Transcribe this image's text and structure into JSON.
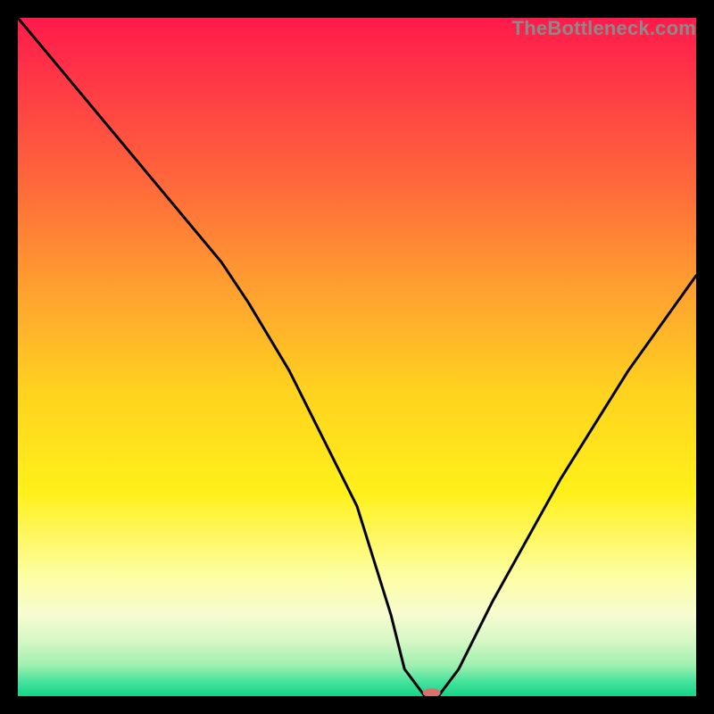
{
  "watermark": "TheBottleneck.com",
  "chart_data": {
    "type": "line",
    "title": "",
    "xlabel": "",
    "ylabel": "",
    "xlim": [
      0,
      100
    ],
    "ylim": [
      0,
      100
    ],
    "grid": false,
    "legend": false,
    "series": [
      {
        "name": "bottleneck-curve",
        "x": [
          0,
          10,
          20,
          30,
          34,
          40,
          50,
          55,
          57,
          60,
          62,
          65,
          70,
          80,
          90,
          100
        ],
        "y": [
          100,
          88,
          76,
          64,
          58,
          48,
          28,
          12,
          4,
          0,
          0,
          4,
          14,
          32,
          48,
          62
        ]
      }
    ],
    "marker": {
      "name": "optimal-point",
      "x": 61,
      "y": 0.5,
      "color": "#d9716f",
      "rx": 10,
      "ry": 5
    },
    "gradient_stops": [
      {
        "offset": 0.0,
        "color": "#ff1a4b"
      },
      {
        "offset": 0.1,
        "color": "#ff3a46"
      },
      {
        "offset": 0.25,
        "color": "#ff6a3a"
      },
      {
        "offset": 0.4,
        "color": "#ffa030"
      },
      {
        "offset": 0.55,
        "color": "#ffd21f"
      },
      {
        "offset": 0.7,
        "color": "#fff01a"
      },
      {
        "offset": 0.82,
        "color": "#fdfea0"
      },
      {
        "offset": 0.88,
        "color": "#f7fbd0"
      },
      {
        "offset": 0.92,
        "color": "#d4f7c4"
      },
      {
        "offset": 0.955,
        "color": "#9df0b0"
      },
      {
        "offset": 0.98,
        "color": "#42e29a"
      },
      {
        "offset": 1.0,
        "color": "#17d48a"
      }
    ]
  }
}
